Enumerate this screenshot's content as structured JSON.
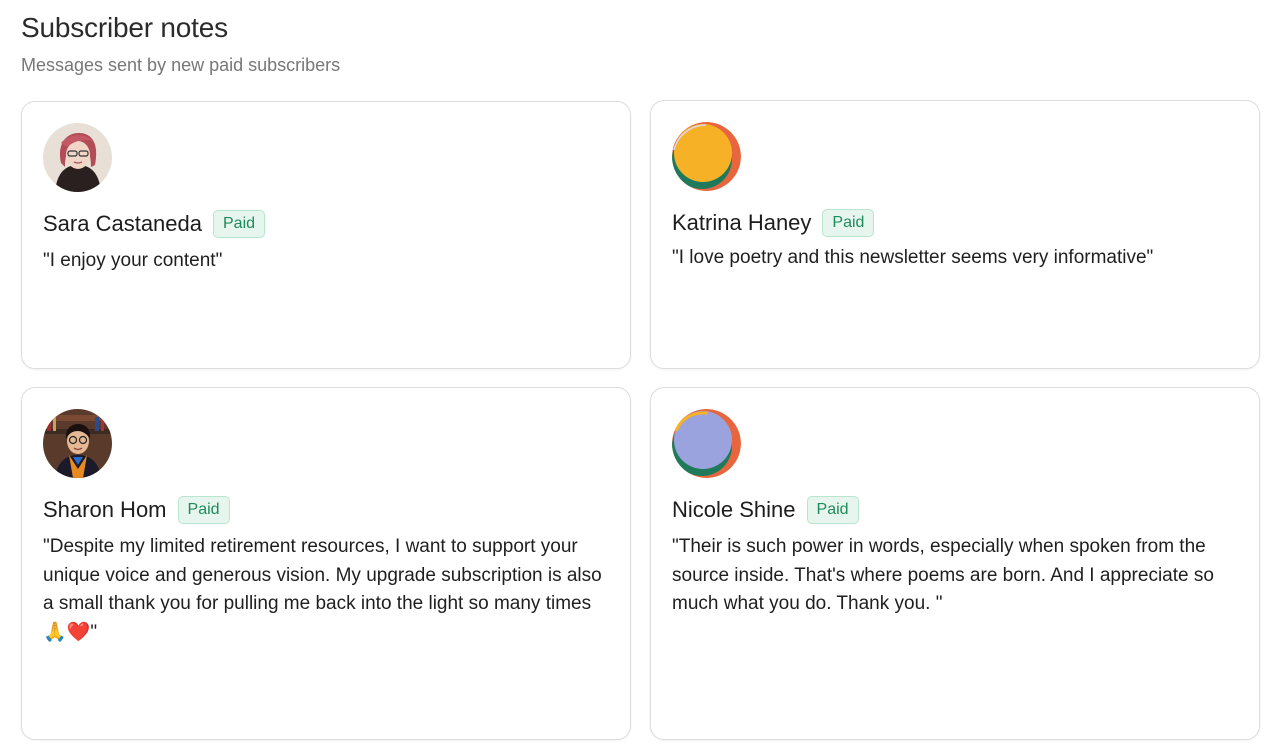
{
  "header": {
    "title": "Subscriber notes",
    "subtitle": "Messages sent by new paid subscribers"
  },
  "notes": [
    {
      "name": "Sara Castaneda",
      "badge": "Paid",
      "message": "\"I enjoy your content\"",
      "avatar": "photo-avatar"
    },
    {
      "name": "Katrina Haney",
      "badge": "Paid",
      "message": "\"I love poetry and this newsletter seems very informative\"",
      "avatar": "generated-avatar",
      "avatar_colors": [
        "#f7b126",
        "#1f7a5c",
        "#e8663d"
      ]
    },
    {
      "name": "Sharon Hom",
      "badge": "Paid",
      "message": "\"Despite my limited retirement resources, I want to support your unique voice and generous vision. My upgrade subscription is also a small thank you for pulling me back into the light so many times🙏❤️\"",
      "avatar": "photo-avatar"
    },
    {
      "name": "Nicole Shine",
      "badge": "Paid",
      "message": "\"Their is such power in words, especially when spoken from the source inside. That's where poems are born. And I appreciate so much what you do. Thank you. \"",
      "avatar": "generated-avatar",
      "avatar_colors": [
        "#9aa3dd",
        "#1f7a5c",
        "#e8663d"
      ]
    }
  ],
  "colors": {
    "badge_text": "#1f8a5a",
    "badge_bg": "#e6f6ee",
    "card_border": "#dddddd"
  }
}
